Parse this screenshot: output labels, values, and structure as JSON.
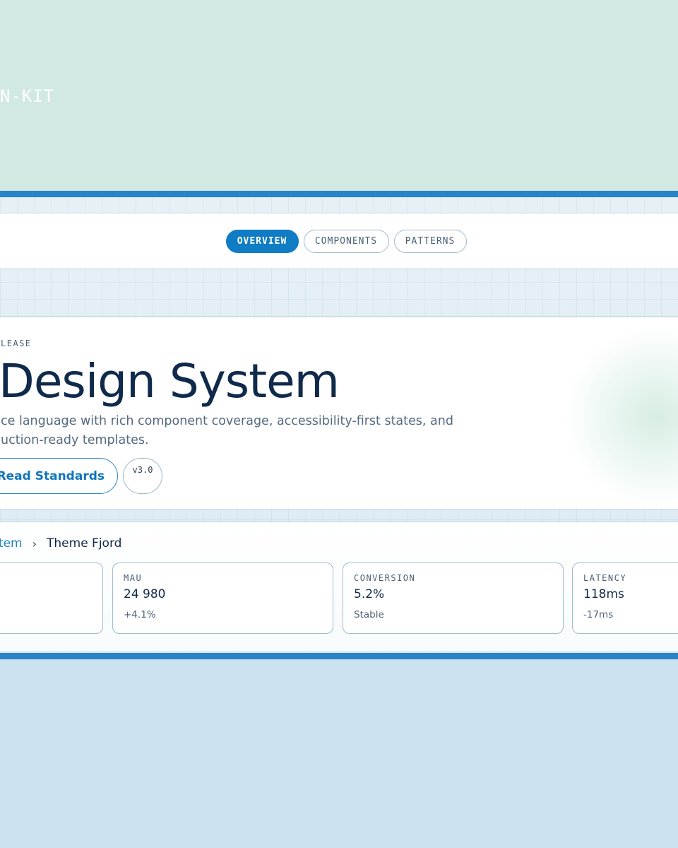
{
  "top": {
    "kit_label": "N-KIT"
  },
  "nav": {
    "tabs": [
      {
        "label": "OVERVIEW",
        "active": true
      },
      {
        "label": "COMPONENTS",
        "active": false
      },
      {
        "label": "PATTERNS",
        "active": false
      }
    ]
  },
  "hero": {
    "eyebrow": "LEASE",
    "title": "Design System",
    "description": "ce language with rich component coverage, accessibility-first states, and uction-ready templates.",
    "primary_button": "Read Standards",
    "version": "v3.0"
  },
  "breadcrumb": {
    "link": "ystem",
    "separator": "›",
    "current": "Theme Fjord"
  },
  "stats": [
    {
      "label": "",
      "value": "",
      "delta": ""
    },
    {
      "label": "MAU",
      "value": "24 980",
      "delta": "+4.1%"
    },
    {
      "label": "CONVERSION",
      "value": "5.2%",
      "delta": "Stable"
    },
    {
      "label": "LATENCY",
      "value": "118ms",
      "delta": "-17ms"
    }
  ],
  "colors": {
    "accent": "#0f7cc4",
    "frame_border": "#2784c6",
    "title": "#102a4c"
  }
}
